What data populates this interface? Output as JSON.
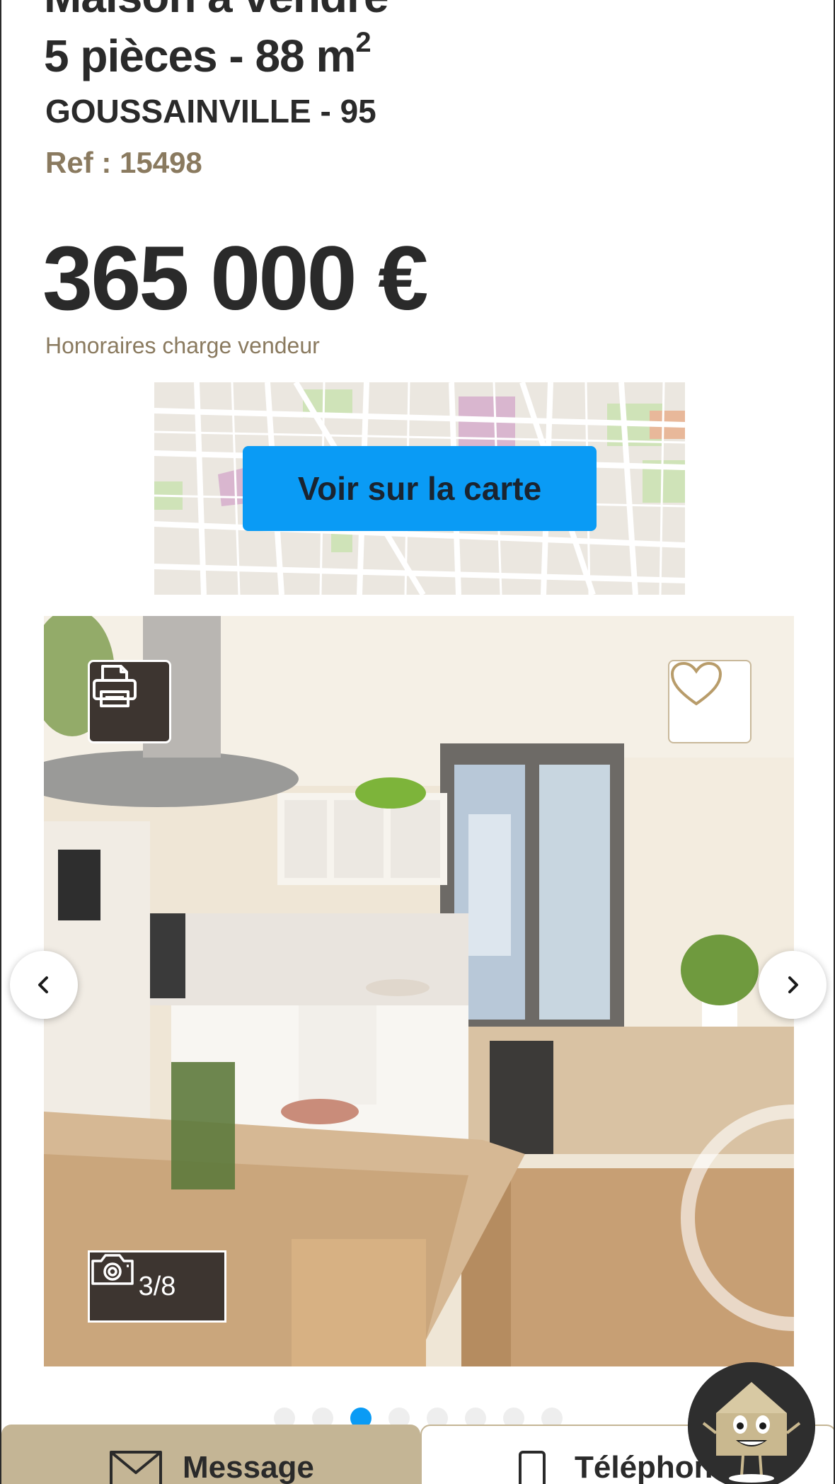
{
  "listing": {
    "title": "Maison à vendre",
    "subtitle_prefix": "5 pièces - 88 m",
    "subtitle_exponent": "2",
    "city": "GOUSSAINVILLE - 95",
    "ref": "Ref : 15498",
    "price": "365 000 €",
    "fees_note": "Honoraires charge vendeur"
  },
  "map": {
    "button_label": "Voir sur la carte"
  },
  "gallery": {
    "counter": "3/8",
    "total_photos": 8,
    "current_index": 3
  },
  "bottom_bar": {
    "message_label": "Message",
    "phone_label": "Téléphone"
  },
  "colors": {
    "accent_blue": "#0a9bf5",
    "brand_gold": "#c4b595",
    "ref_text": "#8a7a5f",
    "dark_overlay": "#3d3530"
  }
}
